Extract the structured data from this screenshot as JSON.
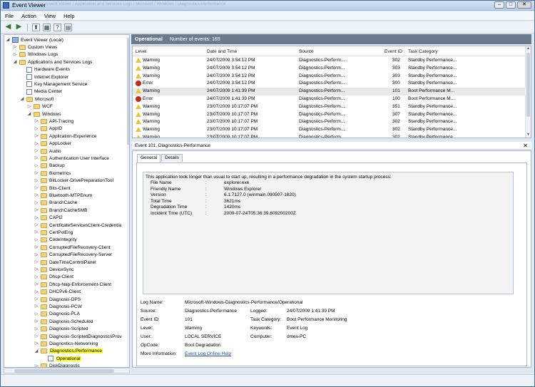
{
  "window": {
    "title": "Event Viewer",
    "title_path_blurred": "Event Viewer / Application and Services Logs / Microsoft / Windows / Diagnostics-Performance"
  },
  "menu": [
    "File",
    "Action",
    "View",
    "Help"
  ],
  "tree": [
    {
      "label": "Event Viewer (Local)",
      "indent": 0,
      "exp": "-",
      "icon": "ev"
    },
    {
      "label": "Custom Views",
      "indent": 1,
      "exp": "+",
      "icon": "folder"
    },
    {
      "label": "Windows Logs",
      "indent": 1,
      "exp": "+",
      "icon": "folder"
    },
    {
      "label": "Applications and Services Logs",
      "indent": 1,
      "exp": "-",
      "icon": "folder"
    },
    {
      "label": "Hardware Events",
      "indent": 2,
      "exp": "",
      "icon": "log"
    },
    {
      "label": "Internet Explorer",
      "indent": 2,
      "exp": "",
      "icon": "log"
    },
    {
      "label": "Key Management Service",
      "indent": 2,
      "exp": "",
      "icon": "log"
    },
    {
      "label": "Media Center",
      "indent": 2,
      "exp": "",
      "icon": "log"
    },
    {
      "label": "Microsoft",
      "indent": 2,
      "exp": "-",
      "icon": "folder"
    },
    {
      "label": "WCF",
      "indent": 3,
      "exp": "+",
      "icon": "folder"
    },
    {
      "label": "Windows",
      "indent": 3,
      "exp": "-",
      "icon": "folder"
    },
    {
      "label": "API-Tracing",
      "indent": 4,
      "exp": "+",
      "icon": "folder"
    },
    {
      "label": "AppID",
      "indent": 4,
      "exp": "+",
      "icon": "folder"
    },
    {
      "label": "Application-Experience",
      "indent": 4,
      "exp": "+",
      "icon": "folder"
    },
    {
      "label": "AppLocker",
      "indent": 4,
      "exp": "+",
      "icon": "folder"
    },
    {
      "label": "Audio",
      "indent": 4,
      "exp": "+",
      "icon": "folder"
    },
    {
      "label": "Authentication User Interface",
      "indent": 4,
      "exp": "+",
      "icon": "folder"
    },
    {
      "label": "Backup",
      "indent": 4,
      "exp": "+",
      "icon": "folder"
    },
    {
      "label": "Biometrics",
      "indent": 4,
      "exp": "+",
      "icon": "folder"
    },
    {
      "label": "BitLocker-DrivePreparationTool",
      "indent": 4,
      "exp": "+",
      "icon": "folder"
    },
    {
      "label": "Bits-Client",
      "indent": 4,
      "exp": "+",
      "icon": "folder"
    },
    {
      "label": "Bluetooth-MTPEnum",
      "indent": 4,
      "exp": "+",
      "icon": "folder"
    },
    {
      "label": "BranchCache",
      "indent": 4,
      "exp": "+",
      "icon": "folder"
    },
    {
      "label": "BranchCacheSMB",
      "indent": 4,
      "exp": "+",
      "icon": "folder"
    },
    {
      "label": "CAPI2",
      "indent": 4,
      "exp": "+",
      "icon": "folder"
    },
    {
      "label": "CertificateServicesClient-Credentia",
      "indent": 4,
      "exp": "+",
      "icon": "folder"
    },
    {
      "label": "CertPolEng",
      "indent": 4,
      "exp": "+",
      "icon": "folder"
    },
    {
      "label": "CodeIntegrity",
      "indent": 4,
      "exp": "+",
      "icon": "folder"
    },
    {
      "label": "CorruptedFileRecovery-Client",
      "indent": 4,
      "exp": "+",
      "icon": "folder"
    },
    {
      "label": "CorruptedFileRecovery-Server",
      "indent": 4,
      "exp": "+",
      "icon": "folder"
    },
    {
      "label": "DateTimeControlPanel",
      "indent": 4,
      "exp": "+",
      "icon": "folder"
    },
    {
      "label": "DeviceSync",
      "indent": 4,
      "exp": "+",
      "icon": "folder"
    },
    {
      "label": "Dhcp-Client",
      "indent": 4,
      "exp": "+",
      "icon": "folder"
    },
    {
      "label": "Dhcp-Nap-Enforcement-Client",
      "indent": 4,
      "exp": "+",
      "icon": "folder"
    },
    {
      "label": "DHCPv6-Client",
      "indent": 4,
      "exp": "+",
      "icon": "folder"
    },
    {
      "label": "Diagnosis-DPS",
      "indent": 4,
      "exp": "+",
      "icon": "folder"
    },
    {
      "label": "Diagnosis-PCW",
      "indent": 4,
      "exp": "+",
      "icon": "folder"
    },
    {
      "label": "Diagnosis-PLA",
      "indent": 4,
      "exp": "+",
      "icon": "folder"
    },
    {
      "label": "Diagnosis-Scheduled",
      "indent": 4,
      "exp": "+",
      "icon": "folder"
    },
    {
      "label": "Diagnosis-Scripted",
      "indent": 4,
      "exp": "+",
      "icon": "folder"
    },
    {
      "label": "Diagnosis-ScriptedDiagnosticsProv",
      "indent": 4,
      "exp": "+",
      "icon": "folder"
    },
    {
      "label": "Diagnostics-Networking",
      "indent": 4,
      "exp": "+",
      "icon": "folder"
    },
    {
      "label": "Diagnostics-Performance",
      "indent": 4,
      "exp": "-",
      "icon": "folder",
      "highlight": true
    },
    {
      "label": "Operational",
      "indent": 5,
      "exp": "",
      "icon": "log",
      "highlight": true
    },
    {
      "label": "DiskDiagnostic",
      "indent": 4,
      "exp": "+",
      "icon": "folder"
    }
  ],
  "pane_header": {
    "name": "Operational",
    "count_text": "Number of events: 165"
  },
  "columns": [
    "Level",
    "Date and Time",
    "Source",
    "Event ID",
    "Task Category"
  ],
  "events": [
    {
      "level": "Warning",
      "datetime": "24/07/2009 3:54:12 PM",
      "source": "Diagnostics-Perform...",
      "id": "302",
      "category": "Standby Performance..."
    },
    {
      "level": "Warning",
      "datetime": "24/07/2009 3:54:12 PM",
      "source": "Diagnostics-Perform...",
      "id": "303",
      "category": "Standby Performance..."
    },
    {
      "level": "Warning",
      "datetime": "24/07/2009 3:54:12 PM",
      "source": "Diagnostics-Perform...",
      "id": "303",
      "category": "Standby Performance..."
    },
    {
      "level": "Error",
      "datetime": "24/07/2009 3:54:12 PM",
      "source": "Diagnostics-Perform...",
      "id": "300",
      "category": "Standby Performance..."
    },
    {
      "level": "Warning",
      "datetime": "24/07/2009 1:41:39 PM",
      "source": "Diagnostics-Perform...",
      "id": "101",
      "category": "Boot Performance M...",
      "selected": true
    },
    {
      "level": "Error",
      "datetime": "24/07/2009 1:41:39 PM",
      "source": "Diagnostics-Perform...",
      "id": "100",
      "category": "Boot Performance M..."
    },
    {
      "level": "Warning",
      "datetime": "23/07/2009 10:17:07 PM",
      "source": "Diagnostics-Perform...",
      "id": "351",
      "category": "Standby Performance..."
    },
    {
      "level": "Warning",
      "datetime": "23/07/2009 10:17:07 PM",
      "source": "Diagnostics-Perform...",
      "id": "307",
      "category": "Standby Performance..."
    },
    {
      "level": "Warning",
      "datetime": "23/07/2009 10:17:07 PM",
      "source": "Diagnostics-Perform...",
      "id": "302",
      "category": "Standby Performance..."
    },
    {
      "level": "Warning",
      "datetime": "23/07/2009 10:17:07 PM",
      "source": "Diagnostics-Perform...",
      "id": "302",
      "category": "Standby Performance..."
    },
    {
      "level": "Warning",
      "datetime": "23/07/2009 10:17:07 PM",
      "source": "Diagnostics-Perform...",
      "id": "302",
      "category": "Standby Performance..."
    }
  ],
  "detail": {
    "header": "Event 101, Diagnostics-Performance",
    "tabs": [
      "General",
      "Details"
    ],
    "message_intro": "This application took longer than usual to start up, resulting in a performance degradation in the system startup process:",
    "message_fields": [
      {
        "k": "File Name",
        "v": "explorer.exe"
      },
      {
        "k": "Friendly Name",
        "v": "Windows Explorer"
      },
      {
        "k": "Version",
        "v": "6.1.7127.0 (winmain.090507-1820)"
      },
      {
        "k": "Total Time",
        "v": "3621ms"
      },
      {
        "k": "Degradation Time",
        "v": "1420ms"
      },
      {
        "k": "Incident Time (UTC)",
        "v": "2009-07-24T05:36:39.609200200Z"
      }
    ],
    "sep": ":",
    "props": {
      "log_name_k": "Log Name:",
      "log_name_v": "Microsoft-Windows-Diagnostics-Performance/Operational",
      "source_k": "Source:",
      "source_v": "Diagnostics-Performance",
      "logged_k": "Logged:",
      "logged_v": "24/07/2009 1:41:39 PM",
      "eventid_k": "Event ID:",
      "eventid_v": "101",
      "task_k": "Task Category:",
      "task_v": "Boot Performance Monitoring",
      "level_k": "Level:",
      "level_v": "Warning",
      "keywords_k": "Keywords:",
      "keywords_v": "Event Log",
      "user_k": "User:",
      "user_v": "LOCAL SERVICE",
      "computer_k": "Computer:",
      "computer_v": "dmex-PC",
      "opcode_k": "OpCode:",
      "opcode_v": "Boot Degradation",
      "moreinfo_k": "More Information:",
      "moreinfo_v": "Event Log Online Help"
    }
  },
  "colors": {
    "highlight": "#ffff33",
    "header_bg": "#6b7b8e",
    "warning": "#f2c12e",
    "error": "#c8261d"
  }
}
